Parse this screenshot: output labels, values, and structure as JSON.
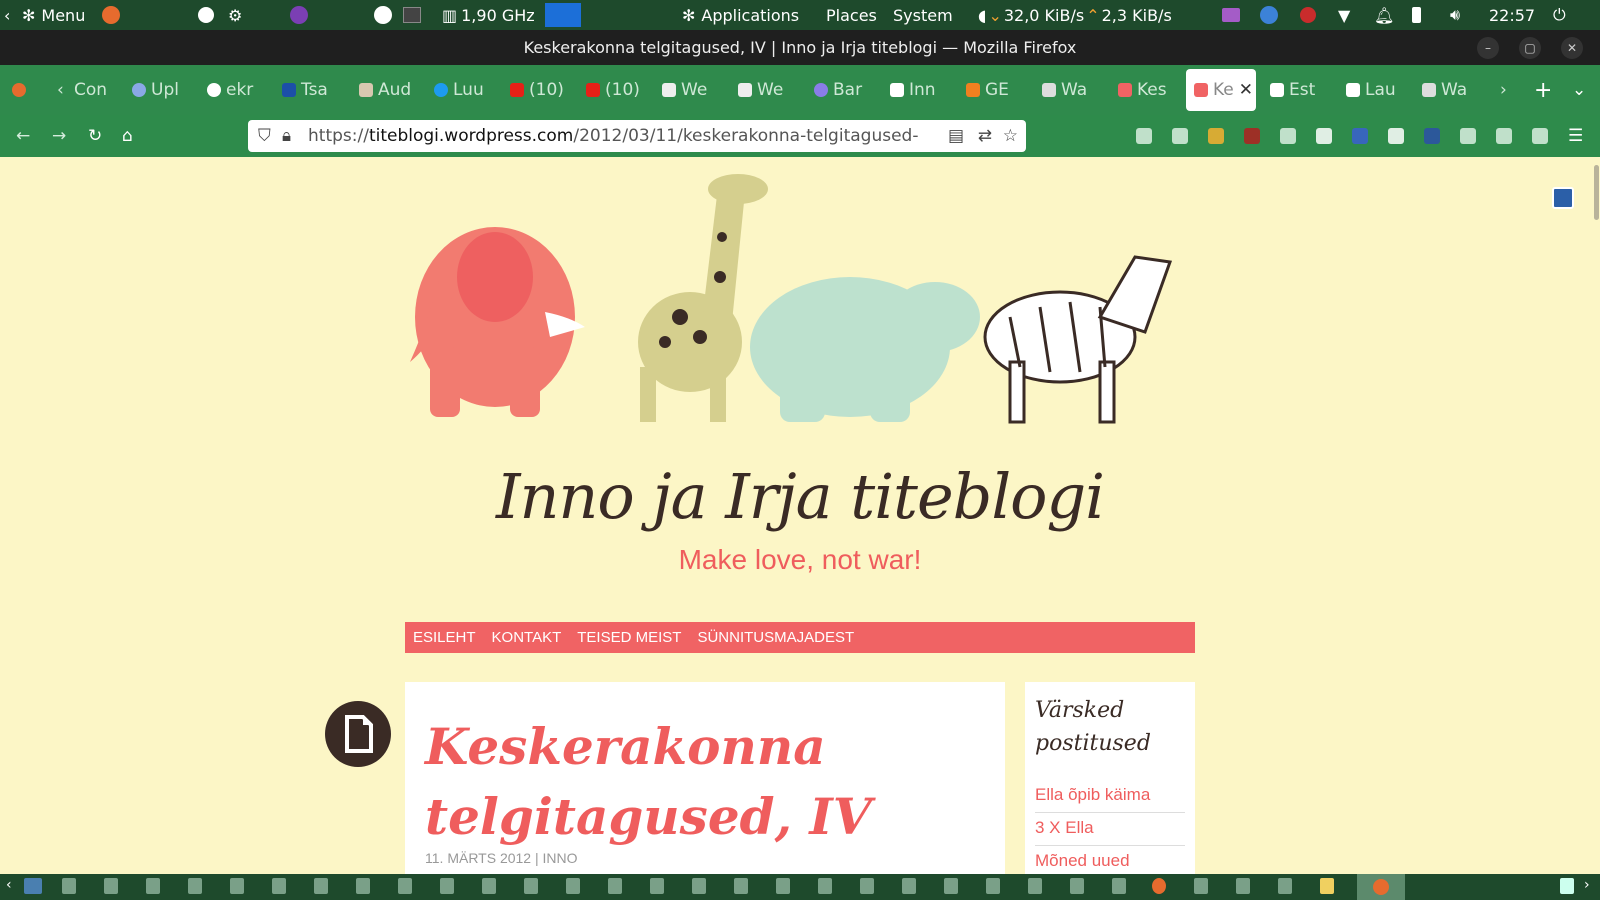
{
  "panel": {
    "menu_label": "Menu",
    "cpu_freq": "1,90 GHz",
    "applications": "Applications",
    "places": "Places",
    "system": "System",
    "net_down": "32,0 KiB/s",
    "net_up": "2,3 KiB/s",
    "clock": "22:57"
  },
  "window": {
    "title": "Keskerakonna telgitagused, IV | Inno ja Irja titeblogi — Mozilla Firefox"
  },
  "tabs": [
    {
      "label": "Con"
    },
    {
      "label": "Upl"
    },
    {
      "label": "ekr"
    },
    {
      "label": "Tsa"
    },
    {
      "label": "Aud"
    },
    {
      "label": "Luu"
    },
    {
      "label": "(10)"
    },
    {
      "label": "(10)"
    },
    {
      "label": "We"
    },
    {
      "label": "We"
    },
    {
      "label": "Bar"
    },
    {
      "label": "Inn"
    },
    {
      "label": "GE"
    },
    {
      "label": "Wa"
    },
    {
      "label": "Kes"
    },
    {
      "label": "Ke"
    },
    {
      "label": "Est"
    },
    {
      "label": "Lau"
    },
    {
      "label": "Wa"
    }
  ],
  "nav": {
    "url_prefix": "https://",
    "url_host": "titeblogi.wordpress.com",
    "url_path": "/2012/03/11/keskerakonna-telgitagused-"
  },
  "site": {
    "title": "Inno ja Irja titeblogi",
    "tagline": "Make love, not war!",
    "menu": [
      "Esileht",
      "Kontakt",
      "Teised meist",
      "Sünnitusmajadest"
    ]
  },
  "post": {
    "title": "Keskerakonna telgitagused, IV",
    "date": "11. märts 2012",
    "separator": "|",
    "author": "Inno"
  },
  "sidebar": {
    "title": "Värsked postitused",
    "items": [
      "Ella õpib käima",
      "3 X Ella",
      "Mõned uued"
    ]
  },
  "colors": {
    "accent": "#f06364",
    "title_dark": "#3a2b25",
    "background": "#fcf6c6",
    "browser_green": "#2e8b4b"
  }
}
